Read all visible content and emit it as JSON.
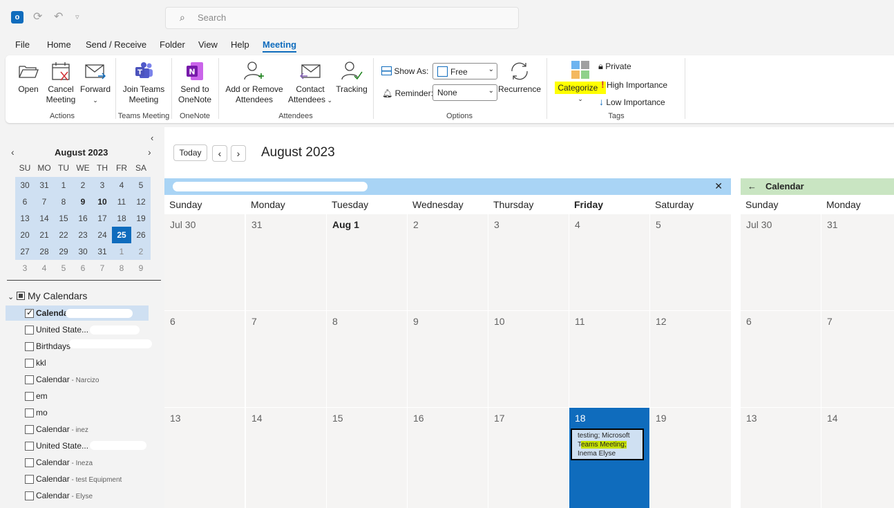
{
  "titlebar": {
    "search_placeholder": "Search"
  },
  "menu": [
    "File",
    "Home",
    "Send / Receive",
    "Folder",
    "View",
    "Help",
    "Meeting"
  ],
  "ribbon": {
    "open": "Open",
    "cancel_meeting": [
      "Cancel",
      "Meeting"
    ],
    "forward": "Forward",
    "actions_label": "Actions",
    "join_teams": [
      "Join Teams",
      "Meeting"
    ],
    "teams_label": "Teams Meeting",
    "send_onenote": [
      "Send to",
      "OneNote"
    ],
    "onenote_label": "OneNote",
    "add_remove": [
      "Add or Remove",
      "Attendees"
    ],
    "contact_attendees": [
      "Contact",
      "Attendees"
    ],
    "tracking": "Tracking",
    "attendees_label": "Attendees",
    "show_as_label": "Show As:",
    "show_as_value": "Free",
    "reminder_label": "Reminder:",
    "reminder_value": "None",
    "recurrence": "Recurrence",
    "options_label": "Options",
    "categorize": "Categorize",
    "private": "Private",
    "high_importance": "High Importance",
    "low_importance": "Low Importance",
    "tags_label": "Tags"
  },
  "minical": {
    "title": "August 2023",
    "dow": [
      "SU",
      "MO",
      "TU",
      "WE",
      "TH",
      "FR",
      "SA"
    ],
    "weeks": [
      [
        "30",
        "31",
        "1",
        "2",
        "3",
        "4",
        "5"
      ],
      [
        "6",
        "7",
        "8",
        "9",
        "10",
        "11",
        "12"
      ],
      [
        "13",
        "14",
        "15",
        "16",
        "17",
        "18",
        "19"
      ],
      [
        "20",
        "21",
        "22",
        "23",
        "24",
        "25",
        "26"
      ],
      [
        "27",
        "28",
        "29",
        "30",
        "31",
        "1",
        "2"
      ],
      [
        "3",
        "4",
        "5",
        "6",
        "7",
        "8",
        "9"
      ]
    ]
  },
  "calendars": {
    "heading": "My Calendars",
    "items": [
      {
        "name": "Calendar",
        "owner": "",
        "checked": true
      },
      {
        "name": "United State...",
        "owner": "",
        "checked": false
      },
      {
        "name": "Birthdays",
        "owner": "",
        "checked": false
      },
      {
        "name": "kkl",
        "owner": "",
        "checked": false
      },
      {
        "name": "Calendar",
        "owner": "Narcizo",
        "checked": false
      },
      {
        "name": "em",
        "owner": "",
        "checked": false
      },
      {
        "name": "mo",
        "owner": "",
        "checked": false
      },
      {
        "name": "Calendar",
        "owner": "inez",
        "checked": false
      },
      {
        "name": "United State...",
        "owner": "",
        "checked": false
      },
      {
        "name": "Calendar",
        "owner": "Ineza",
        "checked": false
      },
      {
        "name": "Calendar",
        "owner": "test Equipment",
        "checked": false
      },
      {
        "name": "Calendar",
        "owner": "Elyse",
        "checked": false
      }
    ]
  },
  "main": {
    "today": "Today",
    "month_title": "August 2023",
    "second_cal_title": "Calendar",
    "daynames": [
      "Sunday",
      "Monday",
      "Tuesday",
      "Wednesday",
      "Thursday",
      "Friday",
      "Saturday"
    ],
    "daynames2": [
      "Sunday",
      "Monday"
    ],
    "rows": [
      [
        "Jul 30",
        "31",
        "Aug 1",
        "2",
        "3",
        "4",
        "5"
      ],
      [
        "6",
        "7",
        "8",
        "9",
        "10",
        "11",
        "12"
      ],
      [
        "13",
        "14",
        "15",
        "16",
        "17",
        "18",
        "19"
      ]
    ],
    "rows2": [
      [
        "Jul 30",
        "31"
      ],
      [
        "6",
        "7"
      ],
      [
        "13",
        "14"
      ]
    ],
    "event": {
      "line1": "testing; Microsoft",
      "line2a": "T",
      "line2b": "eams Meeting;",
      "line3": "Inema Elyse"
    }
  },
  "colors": {
    "accent": "#0f6cbd",
    "selection": "#cfe0f2",
    "cal_header": "#a9d4f5",
    "cal_header2": "#c9e5c2",
    "highlight": "#ffff00"
  }
}
